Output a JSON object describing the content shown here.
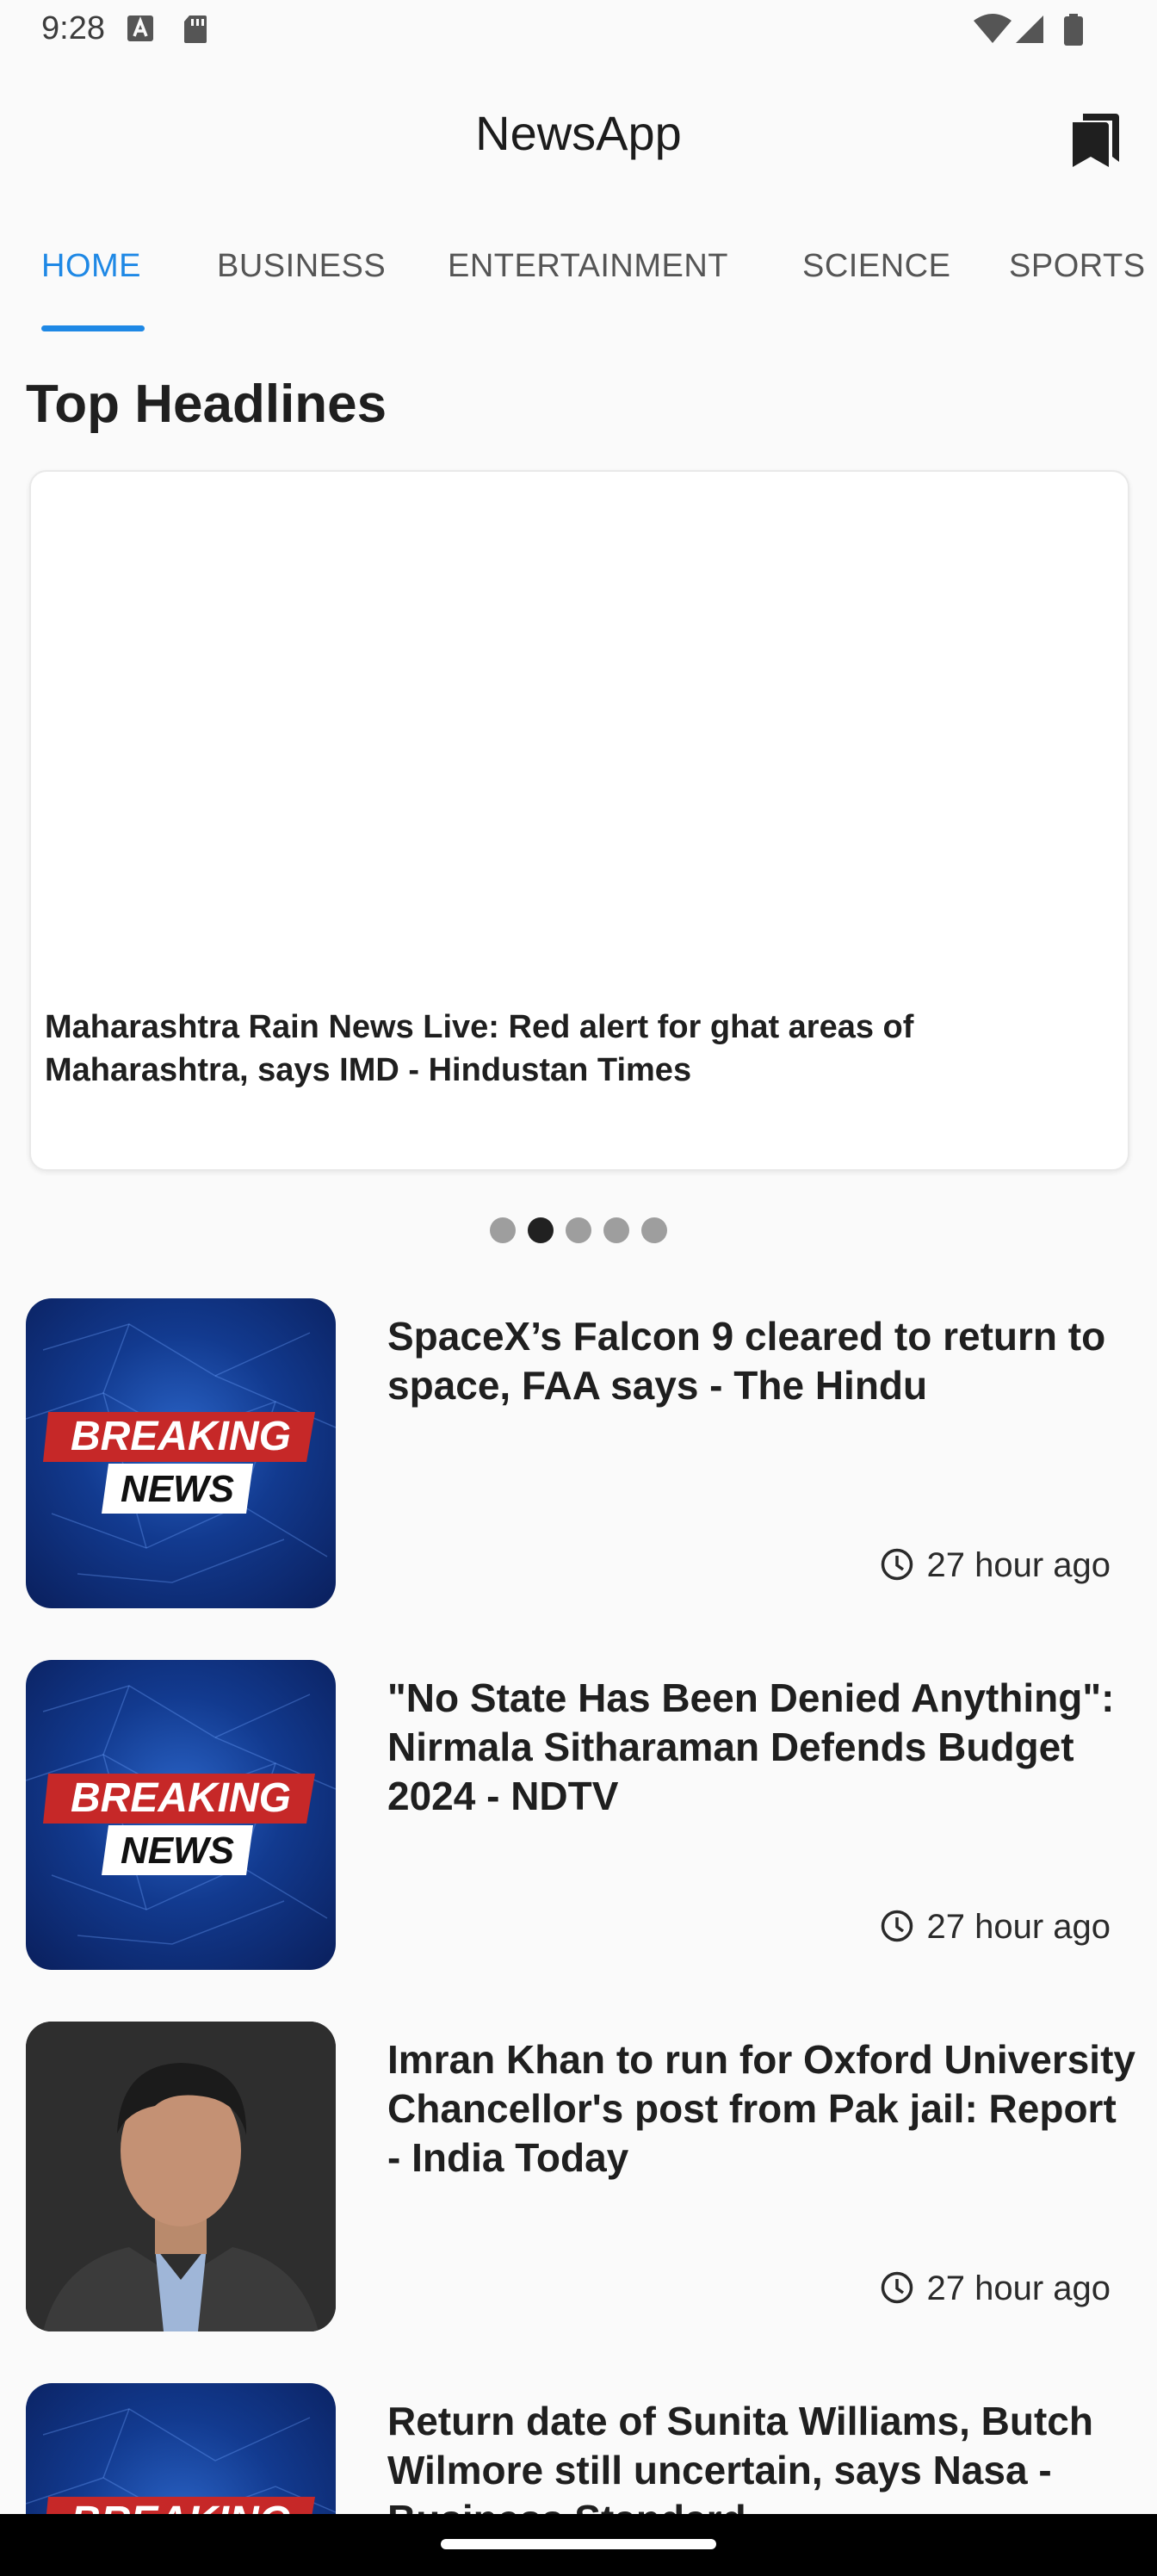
{
  "status_bar": {
    "time": "9:28"
  },
  "app_bar": {
    "title": "NewsApp"
  },
  "tabs": [
    {
      "label": "HOME",
      "active": true
    },
    {
      "label": "BUSINESS",
      "active": false
    },
    {
      "label": "ENTERTAINMENT",
      "active": false
    },
    {
      "label": "SCIENCE",
      "active": false
    },
    {
      "label": "SPORTS",
      "active": false
    }
  ],
  "section": {
    "title": "Top Headlines"
  },
  "top_card": {
    "title": "Maharashtra Rain News Live: Red alert for ghat areas of Maharashtra, says IMD - Hindustan Times"
  },
  "carousel": {
    "total": 5,
    "active_index": 1
  },
  "thumb_text": {
    "breaking": "BREAKING",
    "news": "NEWS"
  },
  "news": [
    {
      "title": "SpaceX’s Falcon 9 cleared to return to space, FAA says - The Hindu",
      "time": "27 hour ago",
      "thumbnail": "breaking-news"
    },
    {
      "title": "\"No State Has Been Denied Anything\": Nirmala Sitharaman Defends Budget 2024 - NDTV",
      "time": "27 hour ago",
      "thumbnail": "breaking-news"
    },
    {
      "title": "Imran Khan to run for Oxford University Chancellor's post from Pak jail: Report - India Today",
      "time": "27 hour ago",
      "thumbnail": "portrait"
    },
    {
      "title": "Return date of Sunita Williams, Butch Wilmore still uncertain, says Nasa - Business Standard",
      "time": "",
      "thumbnail": "breaking-news"
    }
  ],
  "colors": {
    "accent": "#1e88e5",
    "breaking_red": "#c62828"
  },
  "icons": [
    "bookmark-icon",
    "clock-icon",
    "wifi-icon",
    "signal-icon",
    "battery-icon",
    "sd-card-icon",
    "keyboard-a-icon"
  ]
}
